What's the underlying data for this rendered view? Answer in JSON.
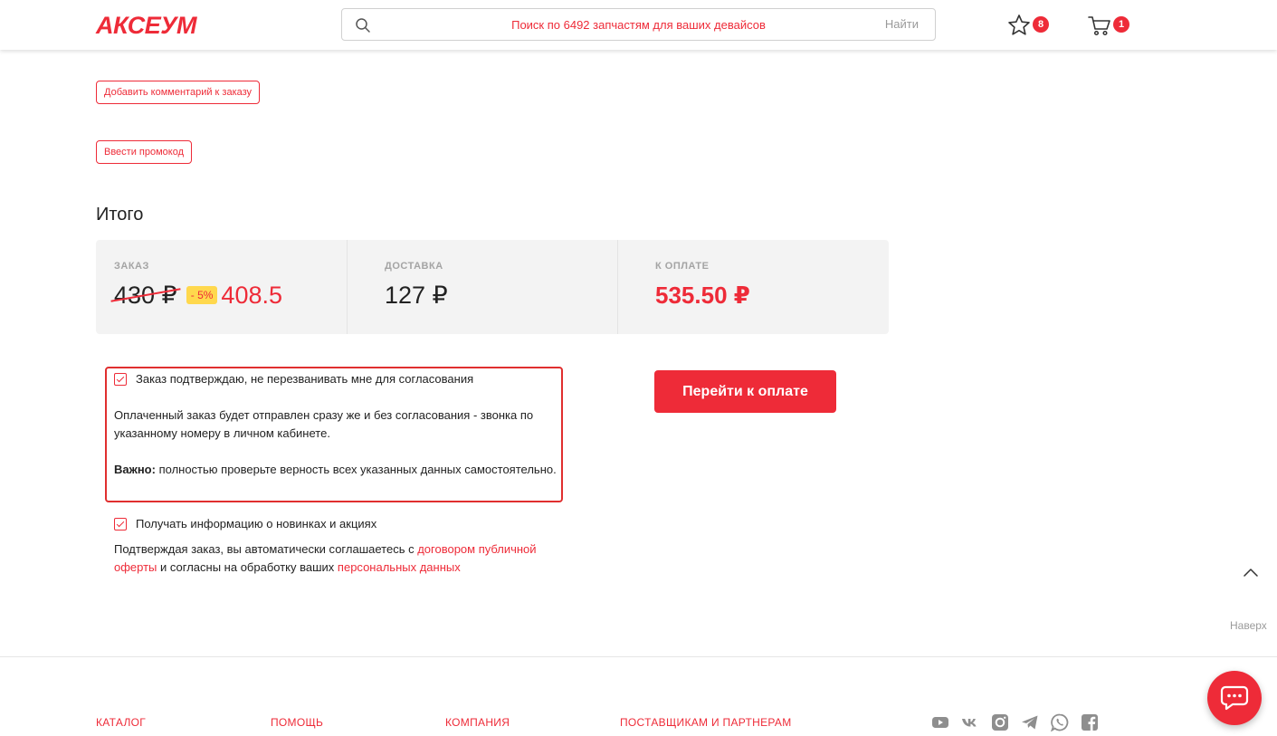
{
  "header": {
    "logo": "АКСЕУМ",
    "search_placeholder": "Поиск по 6492 запчастям для ваших девайсов",
    "search_button": "Найти",
    "favorites_count": "8",
    "cart_count": "1"
  },
  "actions": {
    "add_comment": "Добавить комментарий к заказу",
    "promo": "Ввести промокод"
  },
  "summary": {
    "title": "Итого",
    "order_label": "ЗАКАЗ",
    "order_old": "430 ₽",
    "discount": "- 5%",
    "order_new": "408.5",
    "delivery_label": "ДОСТАВКА",
    "delivery_value": "127 ₽",
    "pay_label": "К ОПЛАТЕ",
    "pay_value": "535.50 ₽"
  },
  "confirm": {
    "checkbox_label": "Заказ подтверждаю, не перезванивать мне для согласования",
    "info": "Оплаченный заказ будет отправлен сразу же и без согласования - звонка по указанному номеру в личном кабинете.",
    "important_label": "Важно:",
    "important_text": " полностью проверьте верность всех указанных данных самостоятельно."
  },
  "newsletter_label": "Получать информацию о новинках и акциях",
  "agreement": {
    "prefix": "Подтверждая заказ, вы автоматически соглашаетесь с ",
    "offer_link": "договором публичной оферты",
    "middle": " и согласны на обработку ваших ",
    "data_link": "персональных данных"
  },
  "pay_button": "Перейти к оплате",
  "to_top": "Наверх",
  "footer": {
    "links": [
      "КАТАЛОГ",
      "ПОМОЩЬ",
      "КОМПАНИЯ",
      "ПОСТАВЩИКАМ И ПАРТНЕРАМ"
    ],
    "socials": [
      "youtube-icon",
      "vk-icon",
      "instagram-icon",
      "telegram-icon",
      "whatsapp-icon",
      "facebook-icon"
    ]
  },
  "colors": {
    "accent": "#ee2b38",
    "badge_yellow": "#ffd84d",
    "summary_bg": "#f3f3f3"
  }
}
